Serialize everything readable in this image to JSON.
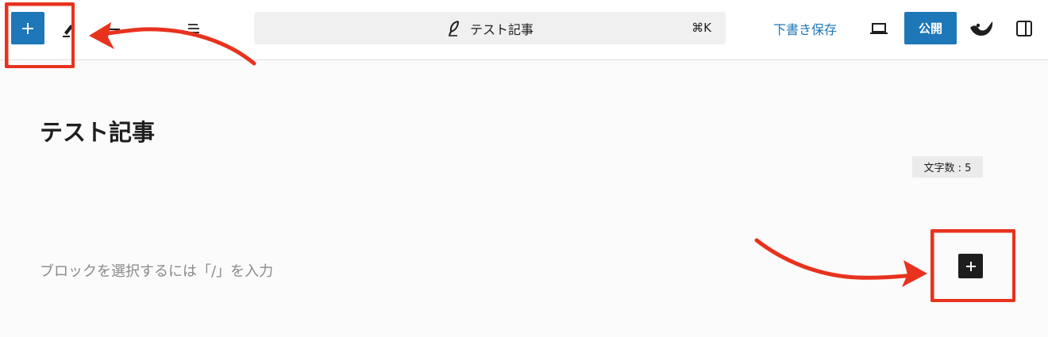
{
  "toolbar": {
    "inserter_icon": "plus-icon",
    "tools_icon": "pen-icon",
    "undo_icon": "undo-icon",
    "list_view_icon": "list-view-icon",
    "command_bar": {
      "icon": "feather-icon",
      "title": "テスト記事",
      "shortcut": "⌘K"
    },
    "save_draft_label": "下書き保存",
    "preview_icon": "laptop-icon",
    "publish_label": "公開",
    "plugin_icon": "jetpack-icon",
    "settings_icon": "sidebar-toggle-icon"
  },
  "editor": {
    "post_title": "テスト記事",
    "word_count": "文字数 : 5",
    "block_placeholder": "ブロックを選択するには「/」を入力",
    "block_inserter_icon": "plus-icon"
  },
  "colors": {
    "accent": "#1e77b8",
    "annotation": "#e8321e",
    "dark": "#1e1e1e"
  }
}
